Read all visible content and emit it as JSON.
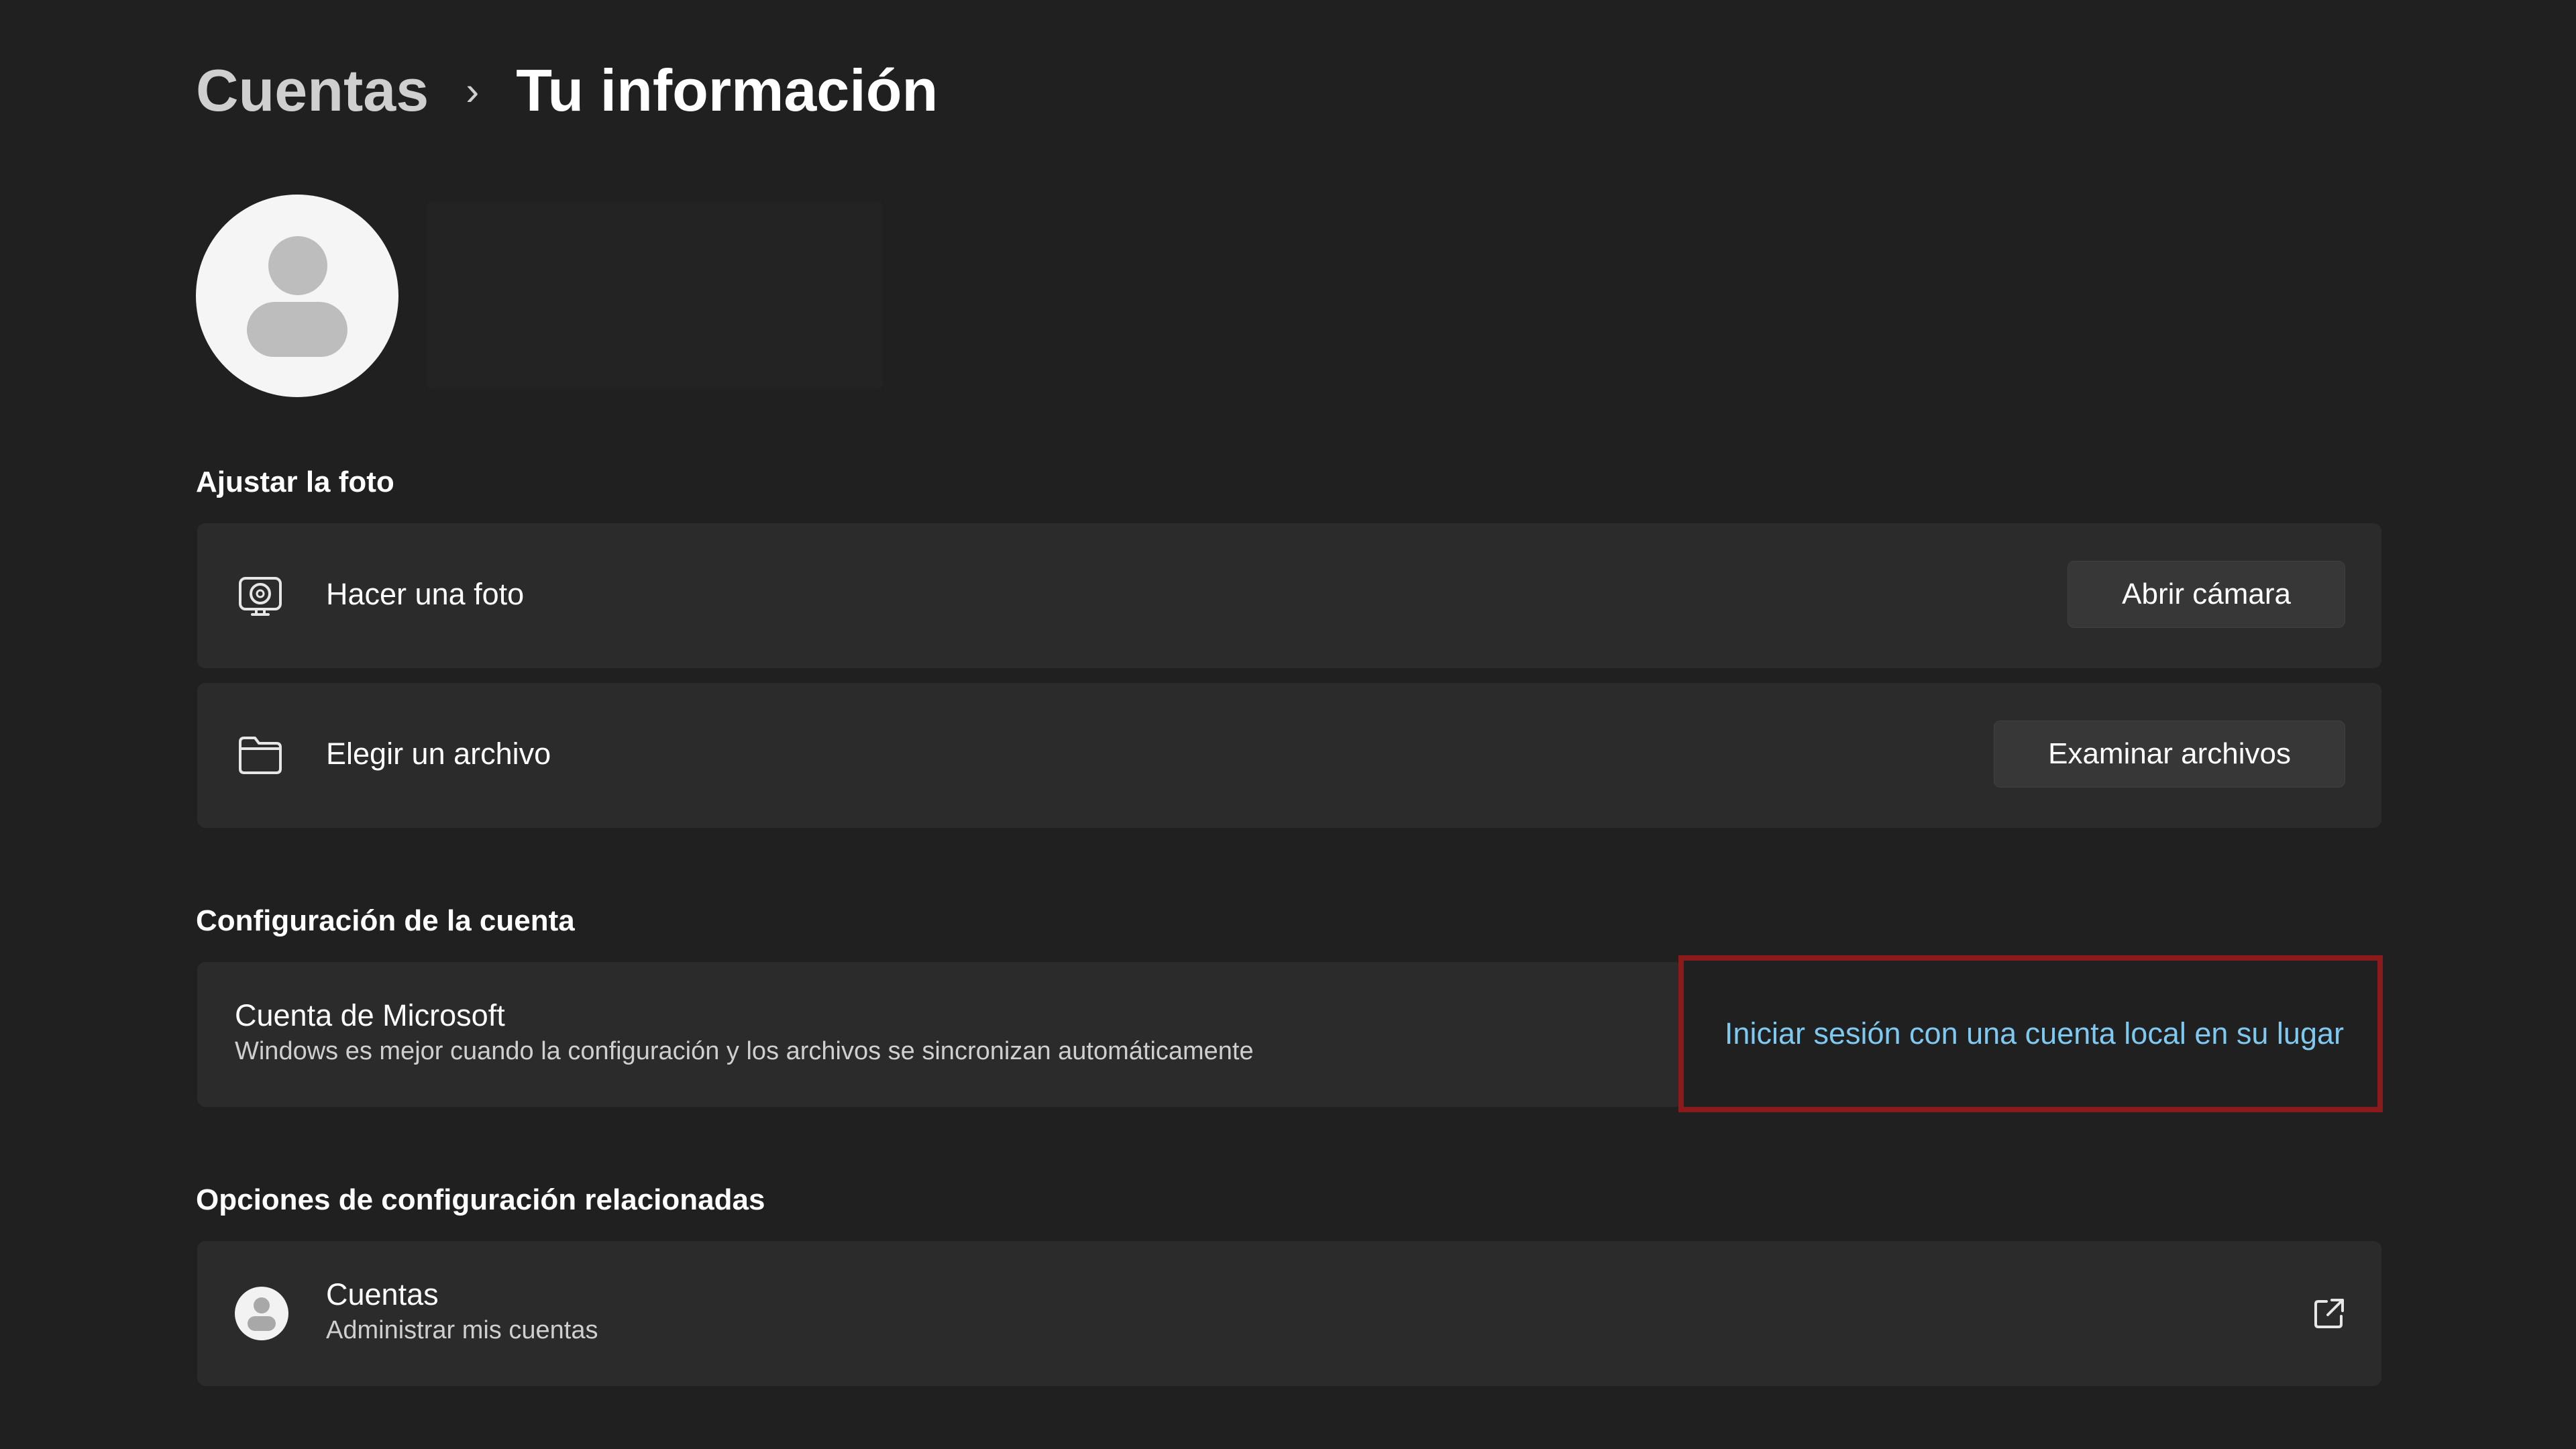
{
  "breadcrumb": {
    "parent": "Cuentas",
    "separator": "›",
    "current": "Tu información"
  },
  "photo_section": {
    "title": "Ajustar la foto",
    "take_photo": {
      "icon": "camera-icon",
      "label": "Hacer una foto",
      "button": "Abrir cámara"
    },
    "choose_file": {
      "icon": "folder-icon",
      "label": "Elegir un archivo",
      "button": "Examinar archivos"
    }
  },
  "account_section": {
    "title": "Configuración de la cuenta",
    "microsoft_account": {
      "title": "Cuenta de Microsoft",
      "description": "Windows es mejor cuando la configuración y los archivos se sincronizan automáticamente",
      "link": "Iniciar sesión con una cuenta local en su lugar"
    }
  },
  "related_section": {
    "title": "Opciones de configuración relacionadas",
    "accounts": {
      "icon": "user-avatar-icon",
      "title": "Cuentas",
      "description": "Administrar mis cuentas",
      "action_icon": "external-link-icon"
    }
  },
  "colors": {
    "background": "#202020",
    "card": "#2b2b2b",
    "link": "#7fc8f0",
    "highlight_border": "#8b1a1a"
  }
}
